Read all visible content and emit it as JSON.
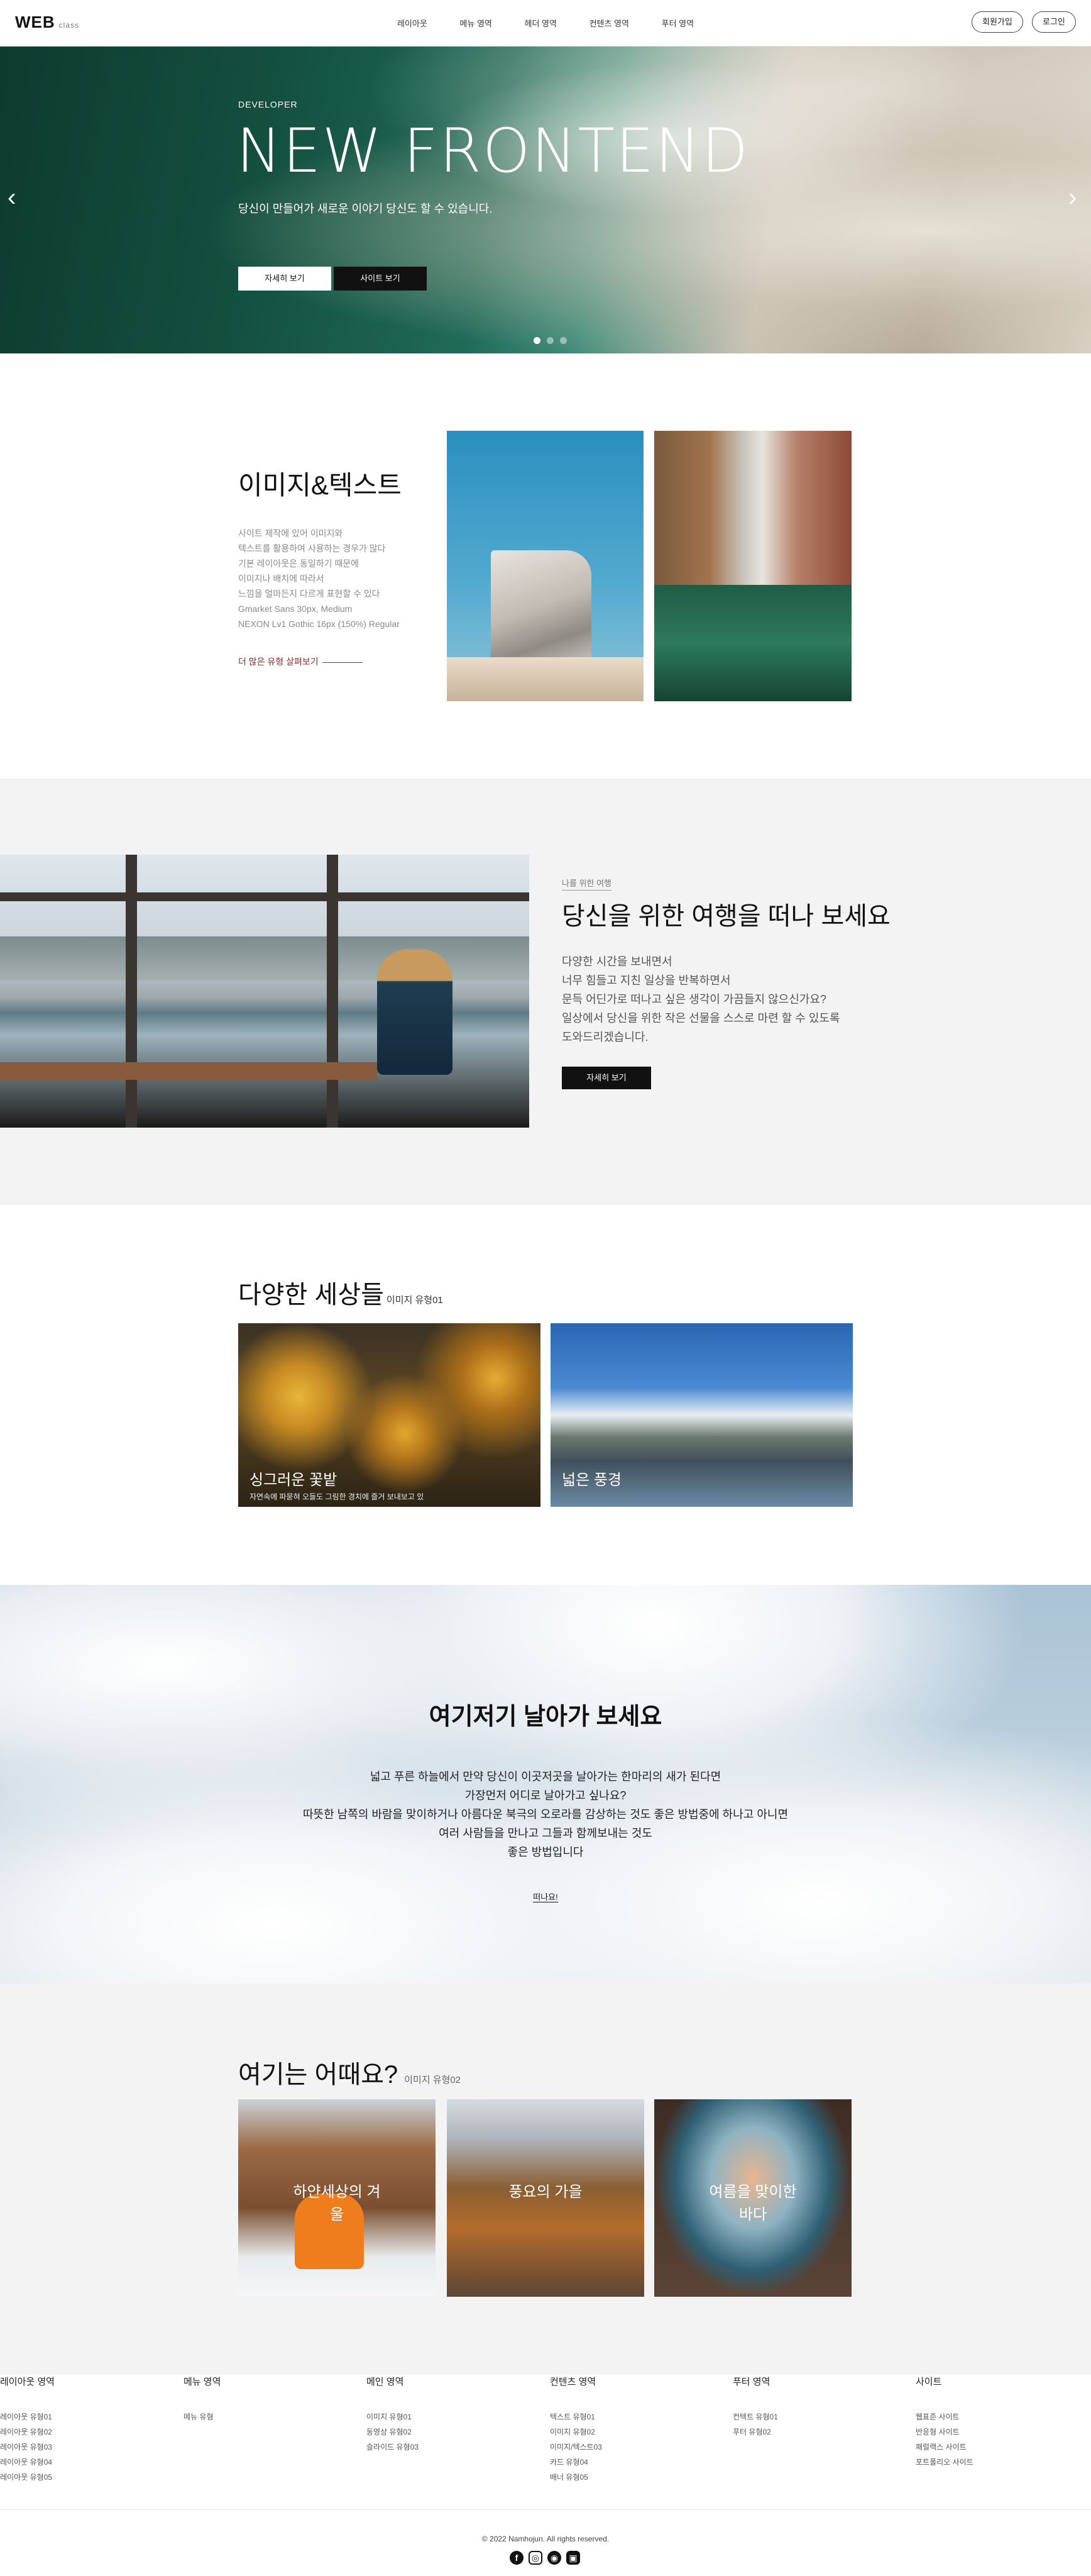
{
  "header": {
    "logo": "WEB",
    "logo_sub": "class",
    "nav": [
      "레이아웃",
      "메뉴 영역",
      "헤더 영역",
      "컨텐츠 영역",
      "푸터 영역"
    ],
    "join_label": "회원가입",
    "login_label": "로그인"
  },
  "hero": {
    "eyebrow": "DEVELOPER",
    "title": "NEW FRONTEND",
    "desc": "당신이 만들어가 새로운 이야기 당신도 할 수 있습니다.",
    "btn_detail": "자세히 보기",
    "btn_site": "사이트 보기",
    "prev_icon": "chevron-left-icon",
    "next_icon": "chevron-right-icon",
    "slide_count": 3,
    "active_slide": 1
  },
  "image_text": {
    "title": "이미지&텍스트",
    "lines": [
      "사이트 제작에 있어 이미지와",
      "텍스트를 활용하여 사용하는 경우가 많다",
      "기본 레이아웃은 동일하기 때문에",
      "이미지나 배치에 따라서",
      "느낌을 얼마든지 다르게 표현할 수 있다",
      "Gmarket Sans 30px, Medium",
      "NEXON Lv1 Gothic 16px (150%) Regular"
    ],
    "link_label": "더 많은 유형 살펴보기"
  },
  "travel": {
    "tag": "나를 위한 여행",
    "title": "당신을 위한 여행을 떠나 보세요",
    "lines": [
      "다양한 시간을 보내면서",
      "너무 힘들고 지친 일상을 반복하면서",
      "문득 어딘가로 떠나고 싶은 생각이 가끔들지 않으신가요?",
      "일상에서 당신을 위한 작은 선물을 스스로 마련 할 수 있도록",
      "도와드리겠습니다."
    ],
    "btn_label": "자세히 보기"
  },
  "worlds": {
    "title": "다양한 세상들",
    "subtitle": "이미지 유형01",
    "cards": [
      {
        "title": "싱그러운 꽃밭",
        "desc": "자연속에 파묻혀 오들도 그림한 경치에 즐거 보내보고 있"
      },
      {
        "title": "넓은 풍경",
        "desc": ""
      }
    ]
  },
  "sky": {
    "title": "여기저기 날아가 보세요",
    "lines": [
      "넓고 푸른 하늘에서 만약 당신이 이곳저곳을 날아가는 한마리의 새가 된다면",
      "가장먼저 어디로 날아가고 싶나요?",
      "따뜻한 남쪽의 바람을 맞이하거나 아름다운 북극의 오로라를 감상하는 것도 좋은 방법중에 하나고 아니면",
      "여러 사람들을 만나고 그들과 함께보내는 것도",
      "좋은 방법입니다"
    ],
    "link_label": "떠나요!"
  },
  "how": {
    "title": "여기는 어때요?",
    "subtitle": "이미지 유형02",
    "cards": [
      {
        "title_line1": "하얀세상의 겨",
        "title_line2": "울"
      },
      {
        "title_line1": "풍요의 가을",
        "title_line2": ""
      },
      {
        "title_line1": "여름을 맞이한",
        "title_line2": "바다"
      }
    ]
  },
  "footer": {
    "columns": [
      {
        "title": "레이아웃 영역",
        "items": [
          "레이아웃 유형01",
          "레이아웃 유형02",
          "레이아웃 유형03",
          "레이아웃 유형04",
          "레이아웃 유형05"
        ]
      },
      {
        "title": "메뉴 영역",
        "items": [
          "메뉴 유형"
        ]
      },
      {
        "title": "메인 영역",
        "items": [
          "이미지 유형01",
          "동영상 유형02",
          "슬라이드 유형03"
        ]
      },
      {
        "title": "컨텐츠 영역",
        "items": [
          "텍스트 유형01",
          "이미지 유형02",
          "이미지/텍스트03",
          "카드 유형04",
          "배너 유형05"
        ]
      },
      {
        "title": "푸터 영역",
        "items": [
          "컨텍트 유형01",
          "푸터 유형02"
        ]
      },
      {
        "title": "사이트",
        "items": [
          "웹표준 사이트",
          "반응형 사이트",
          "패럴랙스 사이트",
          "포트폴리오 사이트"
        ]
      }
    ],
    "copyright": "© 2022 Namhojun. All rights reserved.",
    "social": [
      "facebook-icon",
      "instagram-icon",
      "github-icon",
      "discord-icon"
    ]
  }
}
